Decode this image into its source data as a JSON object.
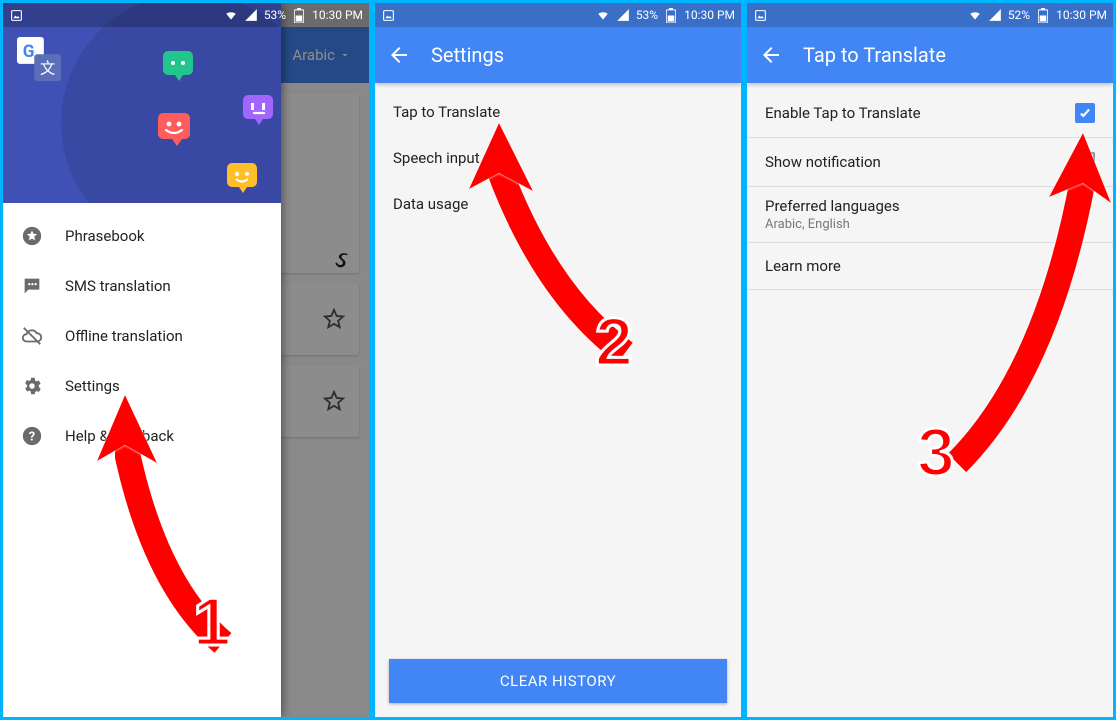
{
  "status": {
    "battery1": "53%",
    "battery2": "53%",
    "battery3": "52%",
    "time": "10:30 PM"
  },
  "panel1": {
    "bg_lang": "Arabic",
    "drawer": {
      "items": [
        {
          "label": "Phrasebook"
        },
        {
          "label": "SMS translation"
        },
        {
          "label": "Offline translation"
        },
        {
          "label": "Settings"
        },
        {
          "label": "Help & feedback"
        }
      ]
    },
    "step": "1"
  },
  "panel2": {
    "title": "Settings",
    "items": [
      {
        "label": "Tap to Translate"
      },
      {
        "label": "Speech input"
      },
      {
        "label": "Data usage"
      }
    ],
    "clear": "CLEAR HISTORY",
    "step": "2"
  },
  "panel3": {
    "title": "Tap to Translate",
    "items": {
      "enable": "Enable Tap to Translate",
      "notify": "Show notification",
      "pref": "Preferred languages",
      "pref_sub": "Arabic, English",
      "learn": "Learn more"
    },
    "step": "3"
  }
}
